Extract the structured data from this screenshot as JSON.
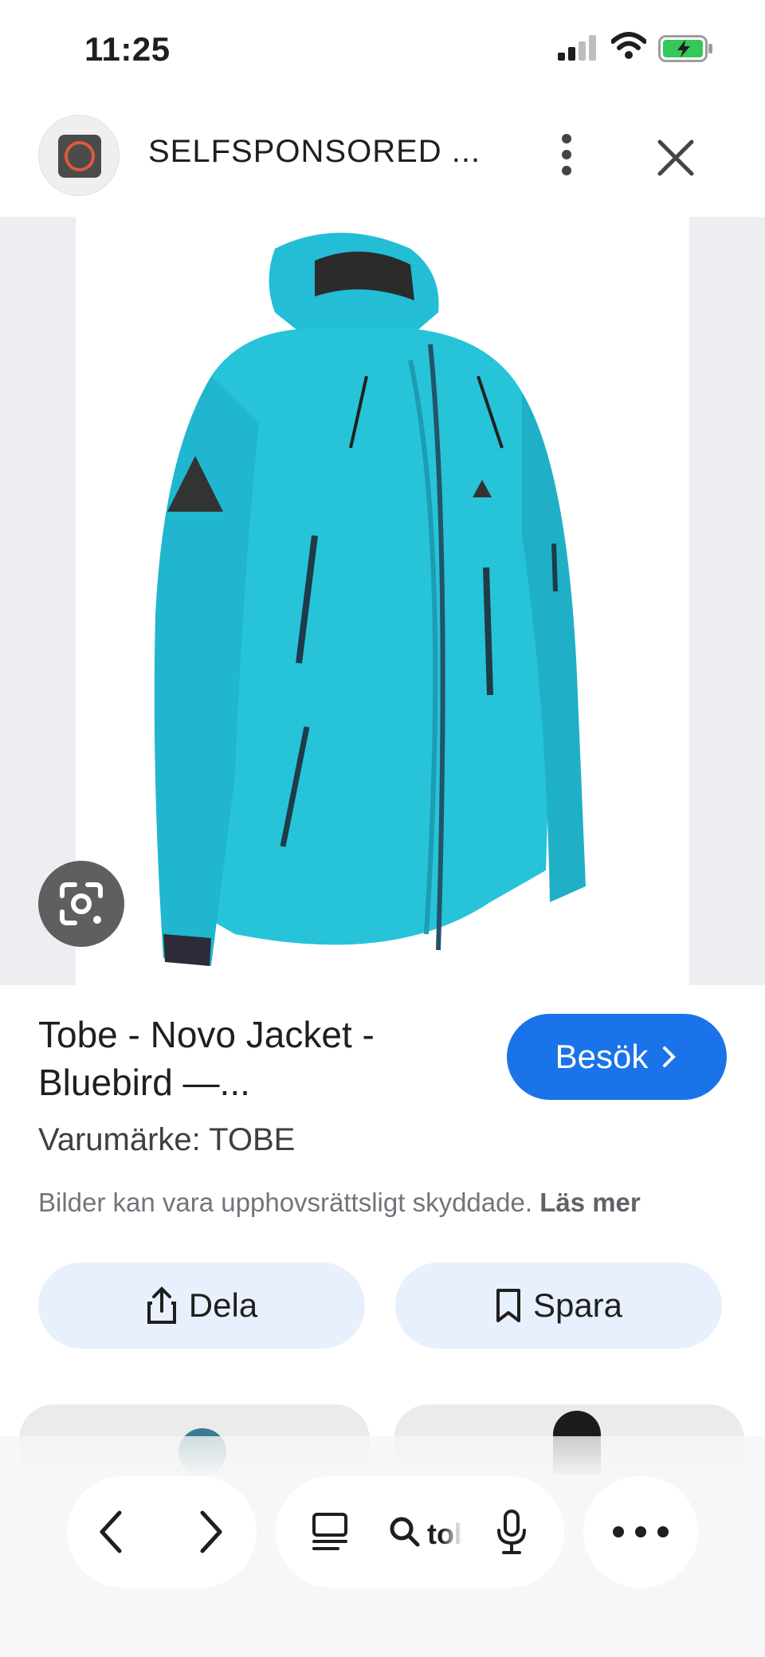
{
  "status_bar": {
    "time": "11:25"
  },
  "header": {
    "site_name": "SELFSPONSORED ..."
  },
  "result": {
    "title_line1": "Tobe - Novo Jacket -",
    "title_line2": "Bluebird —...",
    "visit_label": "Besök",
    "brand": "Varumärke: TOBE",
    "copyright_text": "Bilder kan vara upphovsrättsligt skyddade.",
    "copyright_link": "Läs mer"
  },
  "actions": {
    "share_label": "Dela",
    "save_label": "Spara"
  },
  "toolbar": {
    "search_text": "tobe"
  },
  "colors": {
    "accent": "#1a73e8",
    "jacket": "#27c3d9",
    "action_bg": "#e8f0fe"
  }
}
